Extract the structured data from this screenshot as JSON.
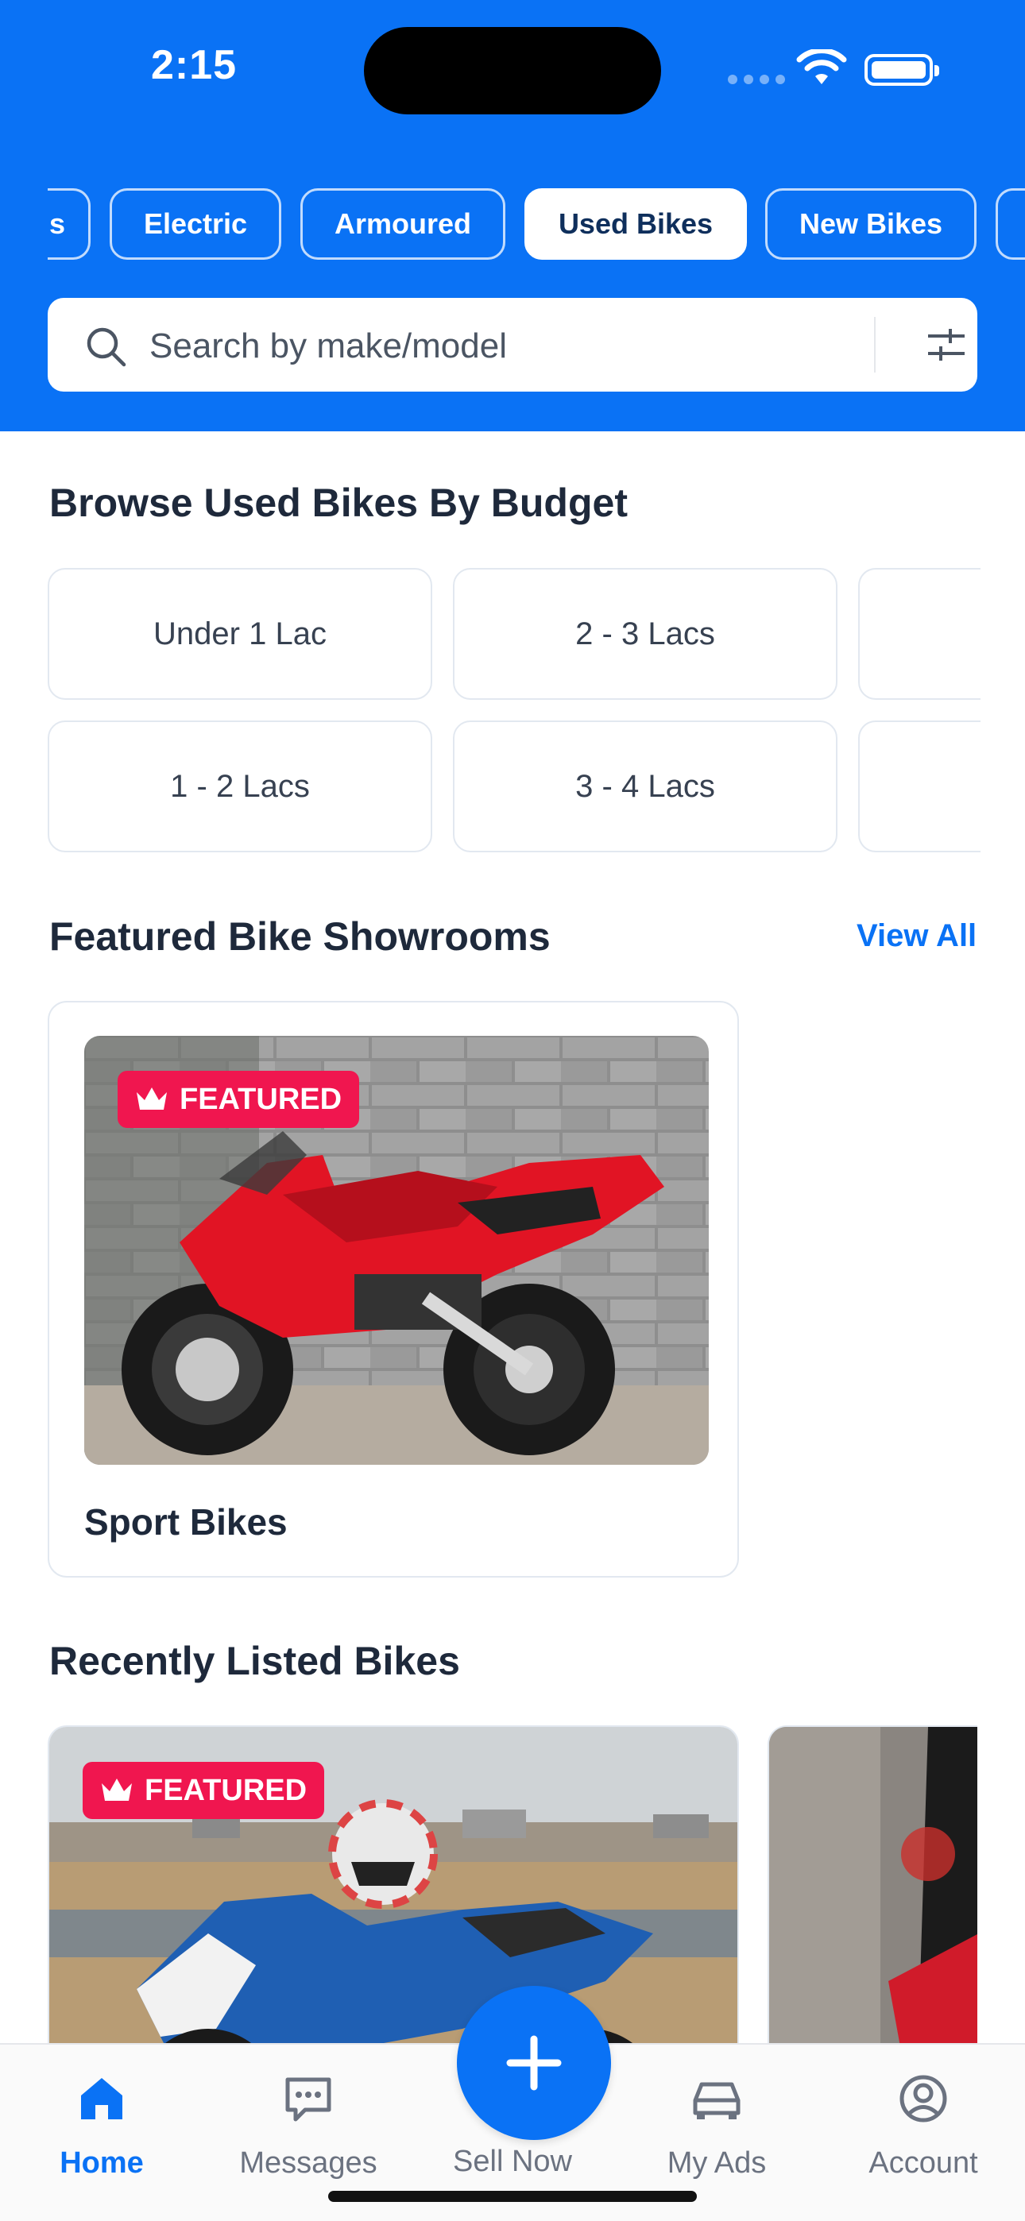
{
  "status_bar": {
    "time": "2:15"
  },
  "category_chips": [
    {
      "label": "s",
      "active": false
    },
    {
      "label": "Electric",
      "active": false
    },
    {
      "label": "Armoured",
      "active": false
    },
    {
      "label": "Used Bikes",
      "active": true
    },
    {
      "label": "New Bikes",
      "active": false
    }
  ],
  "search": {
    "placeholder": "Search by make/model"
  },
  "budget_section": {
    "title": "Browse Used Bikes By Budget",
    "options": [
      "Under 1 Lac",
      "2 - 3 Lacs",
      "1 - 2 Lacs",
      "3 - 4 Lacs"
    ]
  },
  "showrooms_section": {
    "title": "Featured Bike Showrooms",
    "view_all": "View All",
    "items": [
      {
        "name": "Sport Bikes",
        "badge": "FEATURED"
      }
    ]
  },
  "recent_section": {
    "title": "Recently Listed Bikes",
    "items": [
      {
        "badge": "FEATURED"
      }
    ]
  },
  "bottom_nav": {
    "home": "Home",
    "messages": "Messages",
    "sell": "Sell Now",
    "my_ads": "My Ads",
    "account": "Account"
  },
  "colors": {
    "brand": "#0a72f5",
    "featured_badge": "#f0164f"
  },
  "icons": [
    "search-icon",
    "filter-icon",
    "crown-icon",
    "home-icon",
    "message-icon",
    "plus-icon",
    "car-icon",
    "account-icon",
    "wifi-icon",
    "battery-icon"
  ]
}
